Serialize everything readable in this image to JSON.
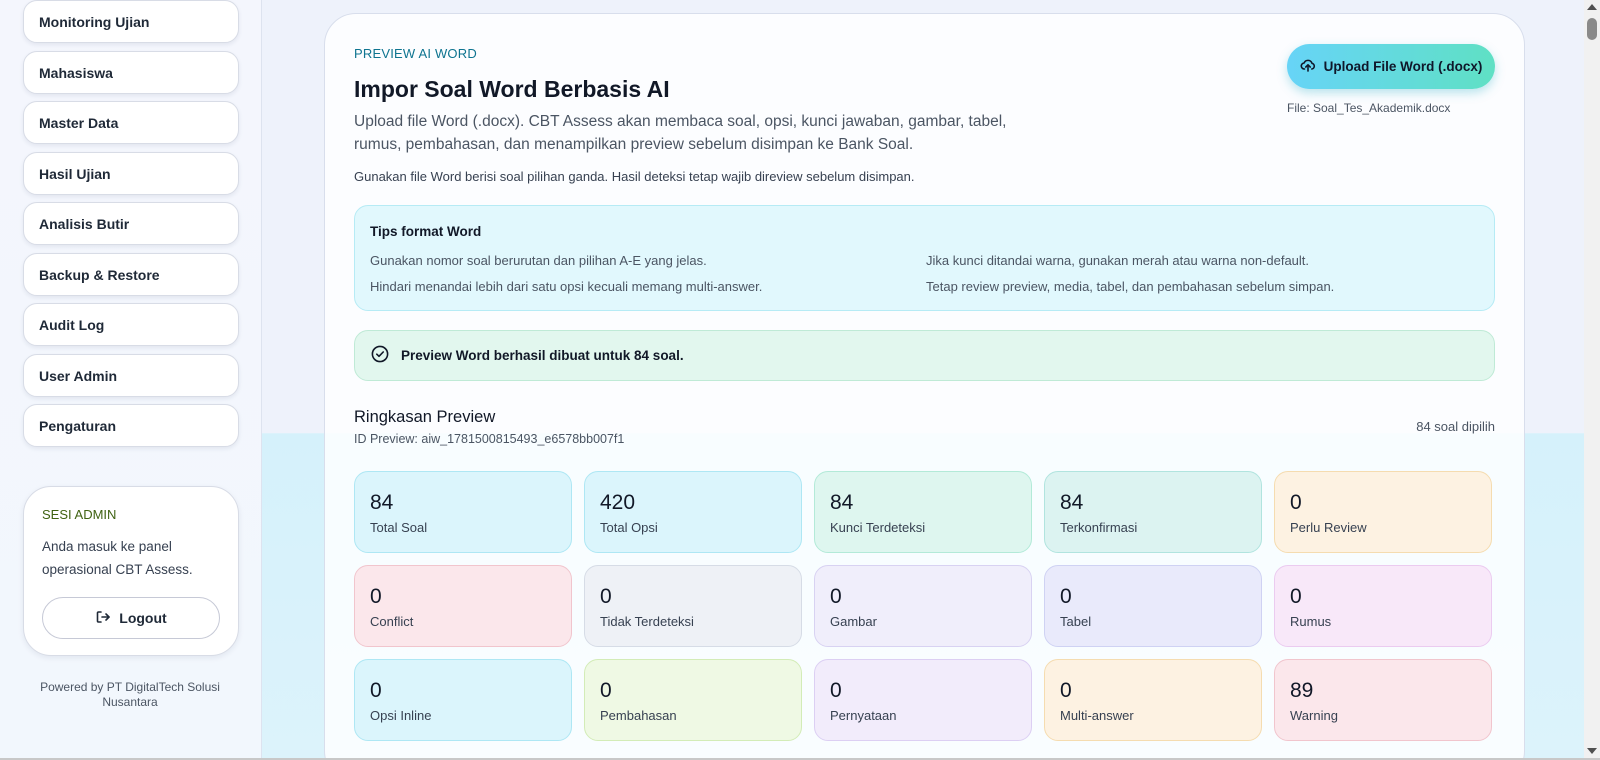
{
  "sidebar": {
    "items": [
      {
        "label": "Monitoring Ujian"
      },
      {
        "label": "Mahasiswa"
      },
      {
        "label": "Master Data"
      },
      {
        "label": "Hasil Ujian"
      },
      {
        "label": "Analisis Butir"
      },
      {
        "label": "Backup & Restore"
      },
      {
        "label": "Audit Log"
      },
      {
        "label": "User Admin"
      },
      {
        "label": "Pengaturan"
      }
    ],
    "session": {
      "title": "SESI ADMIN",
      "description": "Anda masuk ke panel operasional CBT Assess.",
      "logout_label": "Logout",
      "logout_icon": "logout-icon"
    },
    "powered_by": "Powered by PT DigitalTech Solusi Nusantara"
  },
  "header": {
    "eyebrow": "PREVIEW AI WORD",
    "title": "Impor Soal Word Berbasis AI",
    "description": "Upload file Word (.docx). CBT Assess akan membaca soal, opsi, kunci jawaban, gambar, tabel, rumus, pembahasan, dan menampilkan preview sebelum disimpan ke Bank Soal.",
    "note": "Gunakan file Word berisi soal pilihan ganda. Hasil deteksi tetap wajib direview sebelum disimpan.",
    "upload_label": "Upload File Word (.docx)",
    "upload_icon": "cloud-upload-icon",
    "file_name": "File: Soal_Tes_Akademik.docx"
  },
  "tips": {
    "title": "Tips format Word",
    "items": [
      "Gunakan nomor soal berurutan dan pilihan A-E yang jelas.",
      "Jika kunci ditandai warna, gunakan merah atau warna non-default.",
      "Hindari menandai lebih dari satu opsi kecuali memang multi-answer.",
      "Tetap review preview, media, tabel, dan pembahasan sebelum simpan."
    ]
  },
  "success": {
    "message": "Preview Word berhasil dibuat untuk 84 soal.",
    "icon": "check-circle-icon"
  },
  "summary": {
    "title": "Ringkasan Preview",
    "preview_id": "ID Preview: aiw_1781500815493_e6578bb007f1",
    "selected_count": "84 soal dipilih",
    "stats": [
      {
        "value": "84",
        "label": "Total Soal"
      },
      {
        "value": "420",
        "label": "Total Opsi"
      },
      {
        "value": "84",
        "label": "Kunci Terdeteksi"
      },
      {
        "value": "84",
        "label": "Terkonfirmasi"
      },
      {
        "value": "0",
        "label": "Perlu Review"
      },
      {
        "value": "0",
        "label": "Conflict"
      },
      {
        "value": "0",
        "label": "Tidak Terdeteksi"
      },
      {
        "value": "0",
        "label": "Gambar"
      },
      {
        "value": "0",
        "label": "Tabel"
      },
      {
        "value": "0",
        "label": "Rumus"
      },
      {
        "value": "0",
        "label": "Opsi Inline"
      },
      {
        "value": "0",
        "label": "Pembahasan"
      },
      {
        "value": "0",
        "label": "Pernyataan"
      },
      {
        "value": "0",
        "label": "Multi-answer"
      },
      {
        "value": "89",
        "label": "Warning"
      }
    ]
  },
  "colors": {
    "accent": "#0e7490",
    "upload_gradient_start": "#67d4f7",
    "upload_gradient_end": "#5fe0c4",
    "success_bg": "#e2f7ee",
    "tips_bg": "#e1f8fd"
  }
}
